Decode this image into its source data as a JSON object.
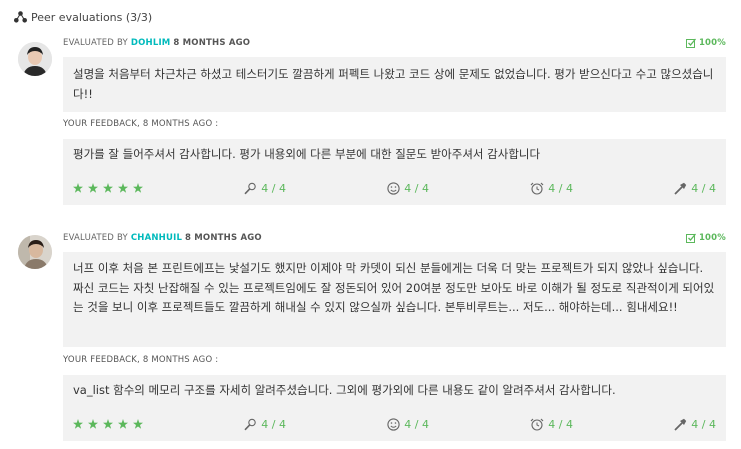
{
  "header": {
    "title": "Peer evaluations (3/3)"
  },
  "evaluations": [
    {
      "evaluated_by_label": "EVALUATED BY",
      "login": "DOHLIM",
      "ago": "8 MONTHS AGO",
      "score": "100%",
      "comment": "설명을 처음부터 차근차근 하셨고 테스터기도 깔끔하게 퍼펙트 나왔고 코드 상에 문제도 없었습니다. 평가 받으신다고 수고 많으셨습니다!!",
      "feedback_label": "YOUR FEEDBACK, 8 MONTHS AGO :",
      "feedback": "평가를 잘 들어주셔서 감사합니다. 평가 내용외에 다른 부분에 대한 질문도 받아주셔서 감사합니다",
      "stars": 5,
      "ratings": [
        "4 / 4",
        "4 / 4",
        "4 / 4",
        "4 / 4"
      ]
    },
    {
      "evaluated_by_label": "EVALUATED BY",
      "login": "CHANHUIL",
      "ago": "8 MONTHS AGO",
      "score": "100%",
      "comment": "너프 이후 처음 본 프린트에프는 낯설기도 했지만 이제야 막 카뎃이 되신 분들에게는 더욱 더 맞는 프로젝트가 되지 않았나 싶습니다. 짜신 코드는 자칫 난잡해질 수 있는 프로젝트임에도 잘 정돈되어 있어 20여분 정도만 보아도 바로 이해가 될 정도로 직관적이게 되어있는 것을 보니 이후 프로젝트들도 깔끔하게 해내실 수 있지 않으실까 싶습니다. 본투비루트는... 저도... 해야하는데... 힘내세요!!",
      "feedback_label": "YOUR FEEDBACK, 8 MONTHS AGO :",
      "feedback": "va_list 함수의 메모리 구조를 자세히 알려주셨습니다. 그외에 평가외에 다른 내용도 같이 알려주셔서 감사합니다.",
      "stars": 5,
      "ratings": [
        "4 / 4",
        "4 / 4",
        "4 / 4",
        "4 / 4"
      ]
    }
  ],
  "icons": {
    "header": "people-network-icon",
    "score": "checkbox-icon",
    "ratings": [
      "thumb-search-icon",
      "smiley-icon",
      "alarm-clock-icon",
      "hammer-icon"
    ]
  },
  "colors": {
    "accent": "#00BABC",
    "success": "#5cb85c",
    "panel": "#f2f2f2"
  }
}
